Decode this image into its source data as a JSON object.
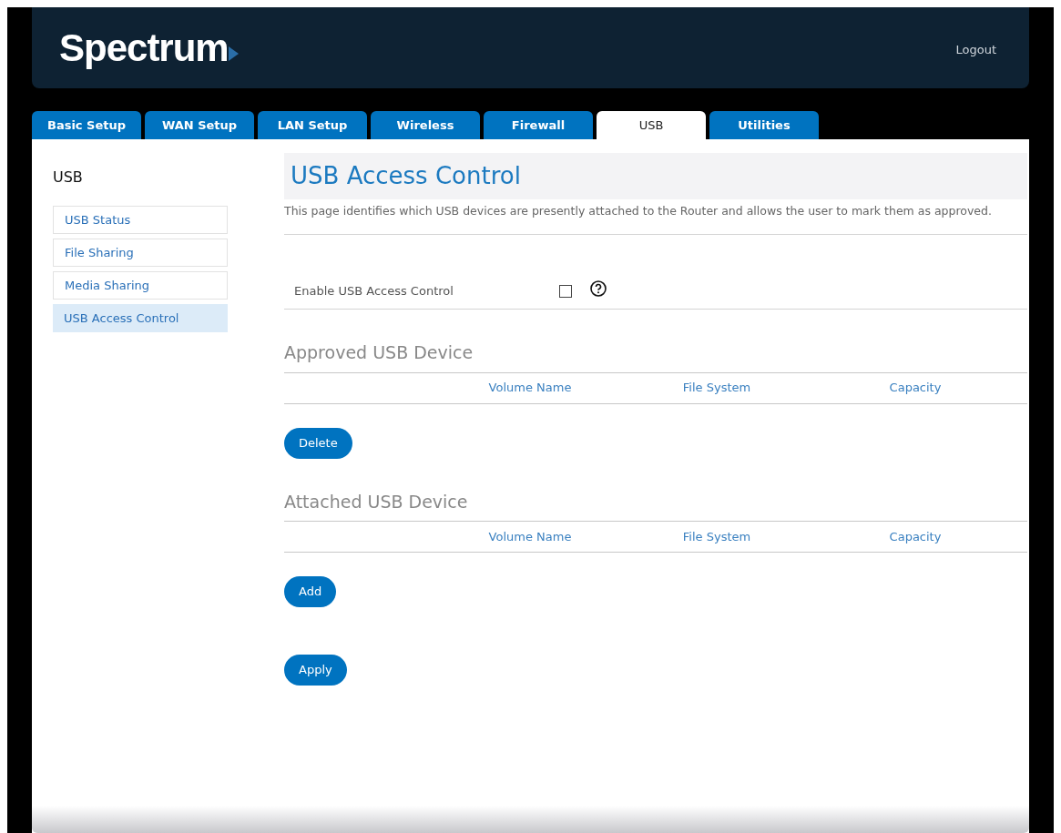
{
  "header": {
    "logo": "Spectrum",
    "logout": "Logout"
  },
  "tabs": [
    {
      "label": "Basic Setup",
      "selected": false
    },
    {
      "label": "WAN Setup",
      "selected": false
    },
    {
      "label": "LAN Setup",
      "selected": false
    },
    {
      "label": "Wireless",
      "selected": false
    },
    {
      "label": "Firewall",
      "selected": false
    },
    {
      "label": "USB",
      "selected": true
    },
    {
      "label": "Utilities",
      "selected": false
    }
  ],
  "sidebar": {
    "title": "USB",
    "items": [
      {
        "label": "USB Status",
        "selected": false
      },
      {
        "label": "File Sharing",
        "selected": false
      },
      {
        "label": "Media Sharing",
        "selected": false
      },
      {
        "label": "USB Access Control",
        "selected": true
      }
    ]
  },
  "page": {
    "title": "USB Access Control",
    "description": "This page identifies which USB devices are presently attached to the Router and allows the user to mark them as approved.",
    "enable": {
      "label": "Enable USB Access Control",
      "checked": false
    },
    "sections": [
      {
        "title": "Approved USB Device",
        "columns": [
          "Volume Name",
          "File System",
          "Capacity"
        ],
        "button": "Delete"
      },
      {
        "title": "Attached USB Device",
        "columns": [
          "Volume Name",
          "File System",
          "Capacity"
        ],
        "button": "Add"
      }
    ],
    "apply": "Apply"
  }
}
